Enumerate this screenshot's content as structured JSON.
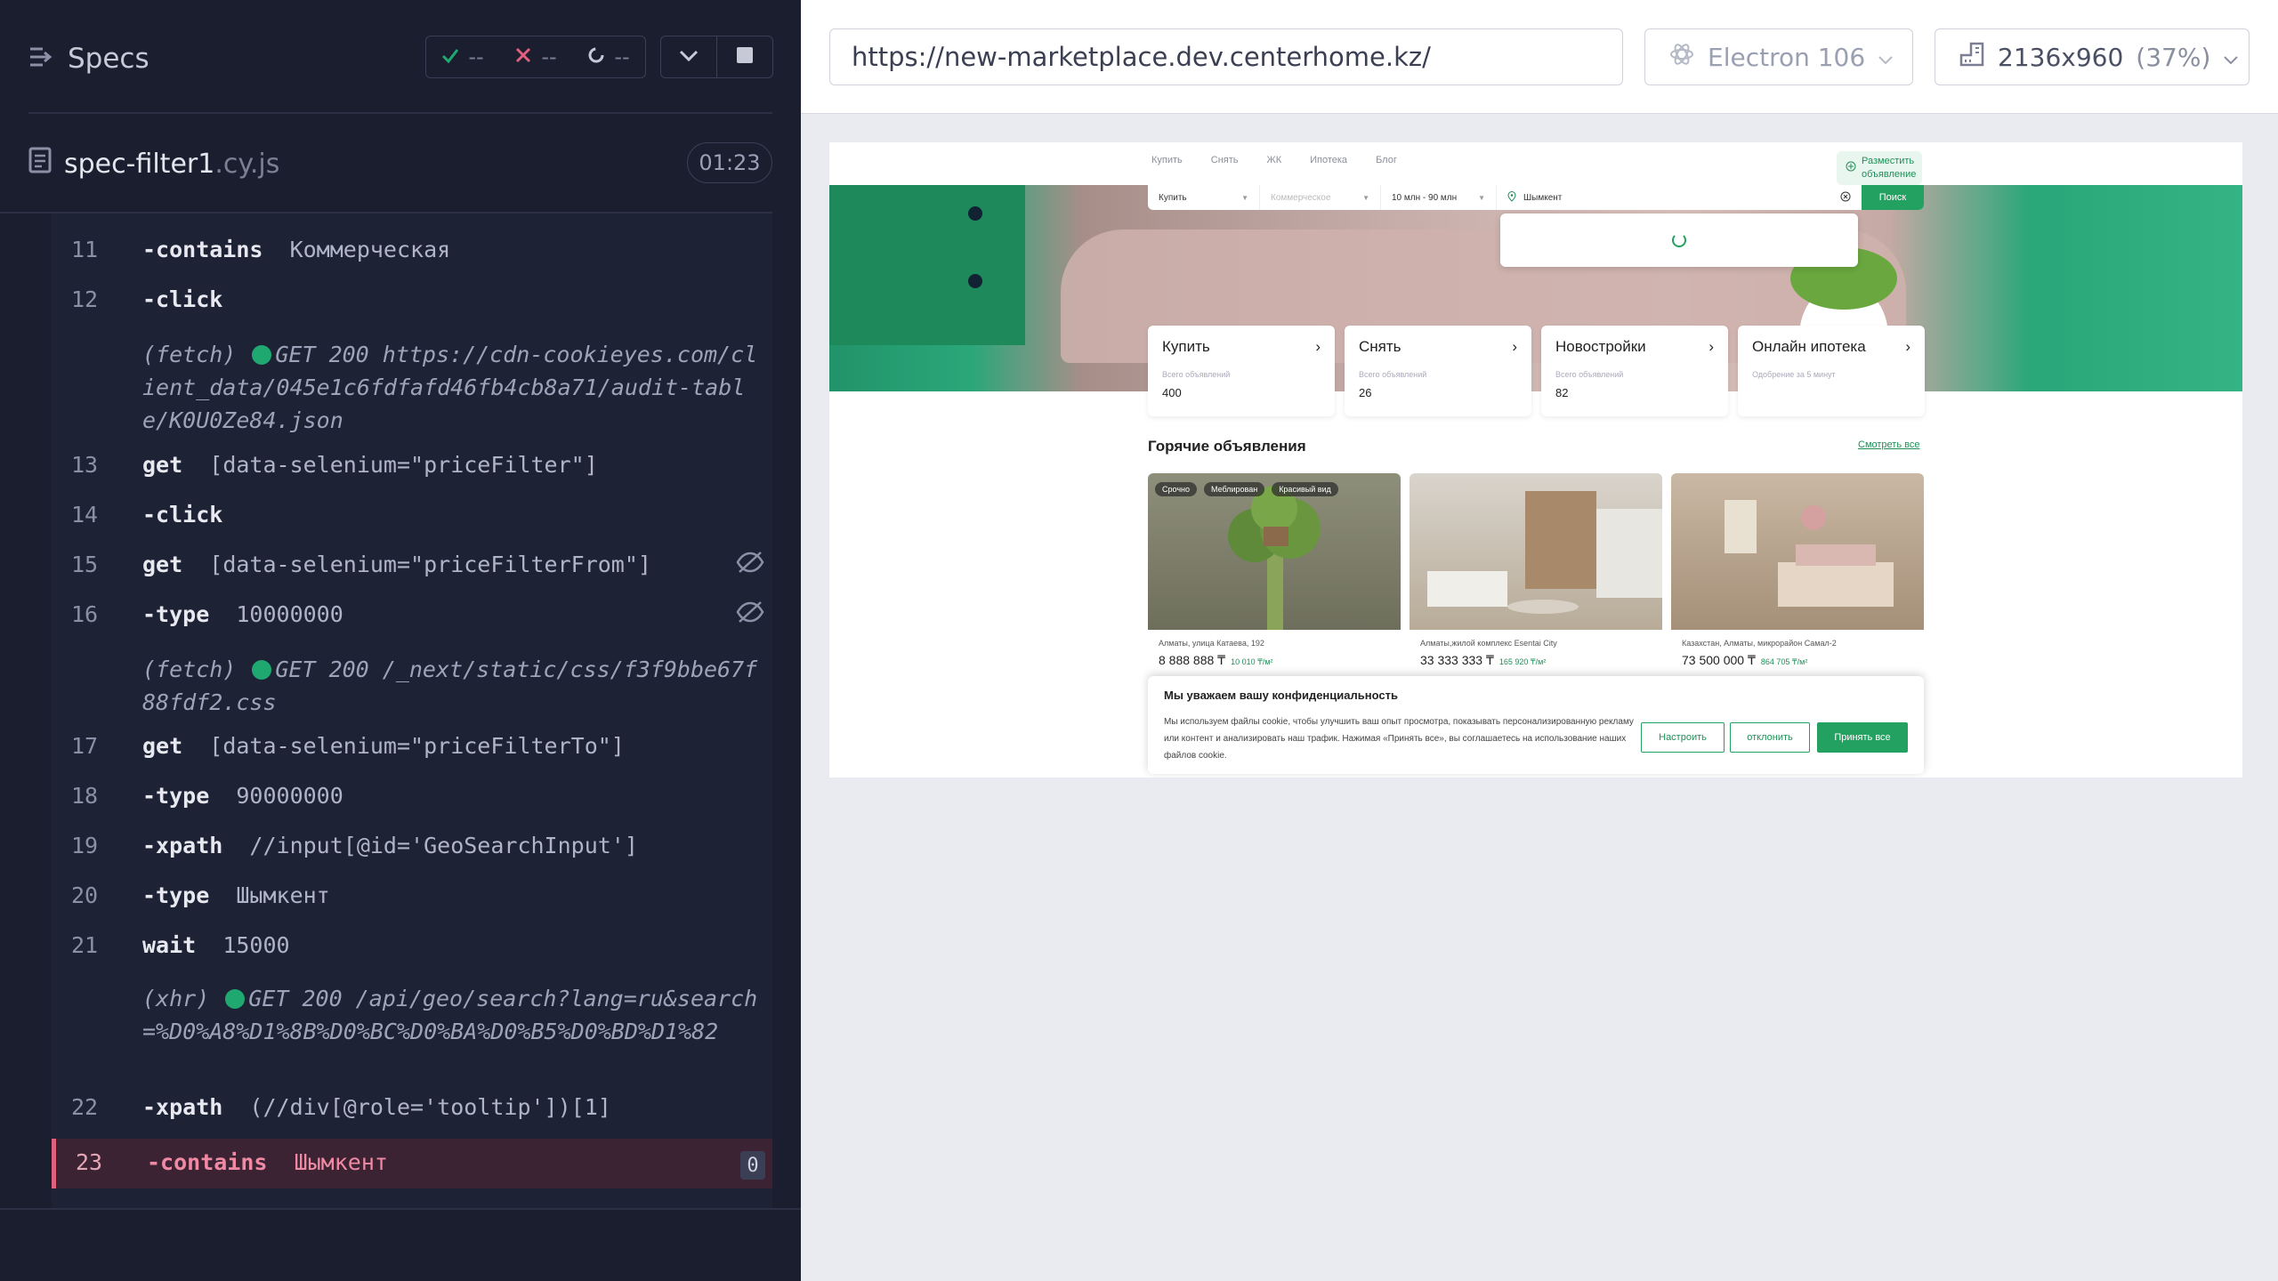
{
  "reporter": {
    "title": "Specs",
    "stats": {
      "passed": "--",
      "failed": "--",
      "pending": "--"
    },
    "spec": {
      "name": "spec-filter1",
      "ext": ".cy.js",
      "duration": "01:23"
    }
  },
  "commands": [
    {
      "num": "11",
      "name": "-contains",
      "arg": "Коммерческая"
    },
    {
      "num": "12",
      "name": "-click",
      "arg": ""
    },
    {
      "log": "(fetch)",
      "text": "GET 200 https://cdn-cookieyes.com/client_data/045e1c6fdfafd46fb4cb8a71/audit-table/K0U0Ze84.json"
    },
    {
      "num": "13",
      "name": "get",
      "arg": "[data-selenium=\"priceFilter\"]"
    },
    {
      "num": "14",
      "name": "-click",
      "arg": ""
    },
    {
      "num": "15",
      "name": "get",
      "arg": "[data-selenium=\"priceFilterFrom\"]"
    },
    {
      "num": "16",
      "name": "-type",
      "arg": "10000000"
    },
    {
      "log": "(fetch)",
      "text": "GET 200 /_next/static/css/f3f9bbe67f88fdf2.css"
    },
    {
      "num": "17",
      "name": "get",
      "arg": "[data-selenium=\"priceFilterTo\"]"
    },
    {
      "num": "18",
      "name": "-type",
      "arg": "90000000"
    },
    {
      "num": "19",
      "name": "-xpath",
      "arg": "//input[@id='GeoSearchInput']"
    },
    {
      "num": "20",
      "name": "-type",
      "arg": "Шымкент"
    },
    {
      "num": "21",
      "name": "wait",
      "arg": "15000"
    },
    {
      "log": "(xhr)",
      "text": "GET 200 /api/geo/search?lang=ru&search=%D0%A8%D1%8B%D0%BC%D0%BA%D0%B5%D0%BD%D1%82"
    },
    {
      "num": "22",
      "name": "-xpath",
      "arg": "(//div[@role='tooltip'])[1]"
    },
    {
      "num": "23",
      "name": "-contains",
      "arg": "Шымкент",
      "badge": "0",
      "failed": true
    }
  ],
  "toolbar": {
    "url": "https://new-marketplace.dev.centerhome.kz/",
    "browser": "Electron 106",
    "viewport": "2136x960",
    "scale": "(37%)"
  },
  "site": {
    "nav": [
      "Купить",
      "Снять",
      "ЖК",
      "Ипотека",
      "Блог"
    ],
    "post_button": "Разместить объявление",
    "search": {
      "deal": "Купить",
      "type_placeholder": "Коммерческое",
      "price": "10 млн - 90 млн",
      "location": "Шымкент",
      "button": "Поиск"
    },
    "categories": [
      {
        "title": "Купить",
        "sub": "Всего объявлений",
        "count": "400"
      },
      {
        "title": "Снять",
        "sub": "Всего объявлений",
        "count": "26"
      },
      {
        "title": "Новостройки",
        "sub": "Всего объявлений",
        "count": "82"
      },
      {
        "title": "Онлайн ипотека",
        "sub": "Одобрение за 5 минут",
        "count": ""
      }
    ],
    "hot_title": "Горячие объявления",
    "see_all": "Смотреть все",
    "listings": [
      {
        "tags": [
          "Срочно",
          "Меблирован",
          "Красивый вид"
        ],
        "address": "Алматы, улица Катаева, 192",
        "price": "8 888 888 ₸",
        "per_m2": "10 010 ₸/м²"
      },
      {
        "tags": [],
        "address": "Алматы,жилой комплекс Esentai City",
        "price": "33 333 333 ₸",
        "per_m2": "165 920 ₸/м²"
      },
      {
        "tags": [],
        "address": "Казахстан, Алматы, микрорайон Самал-2",
        "price": "73 500 000 ₸",
        "per_m2": "864 705 ₸/м²"
      }
    ],
    "cookie": {
      "title": "Мы уважаем вашу конфиденциальность",
      "text": "Мы используем файлы cookie, чтобы улучшить ваш опыт просмотра, показывать персонализированную рекламу или контент и анализировать наш трафик. Нажимая «Принять все», вы соглашаетесь на использование наших файлов cookie.",
      "customize": "Настроить",
      "reject": "отклонить",
      "accept": "Принять все"
    }
  },
  "colors": {
    "panel": "#1b1e2e",
    "accent_green": "#22a160",
    "fail": "#e0607e"
  }
}
